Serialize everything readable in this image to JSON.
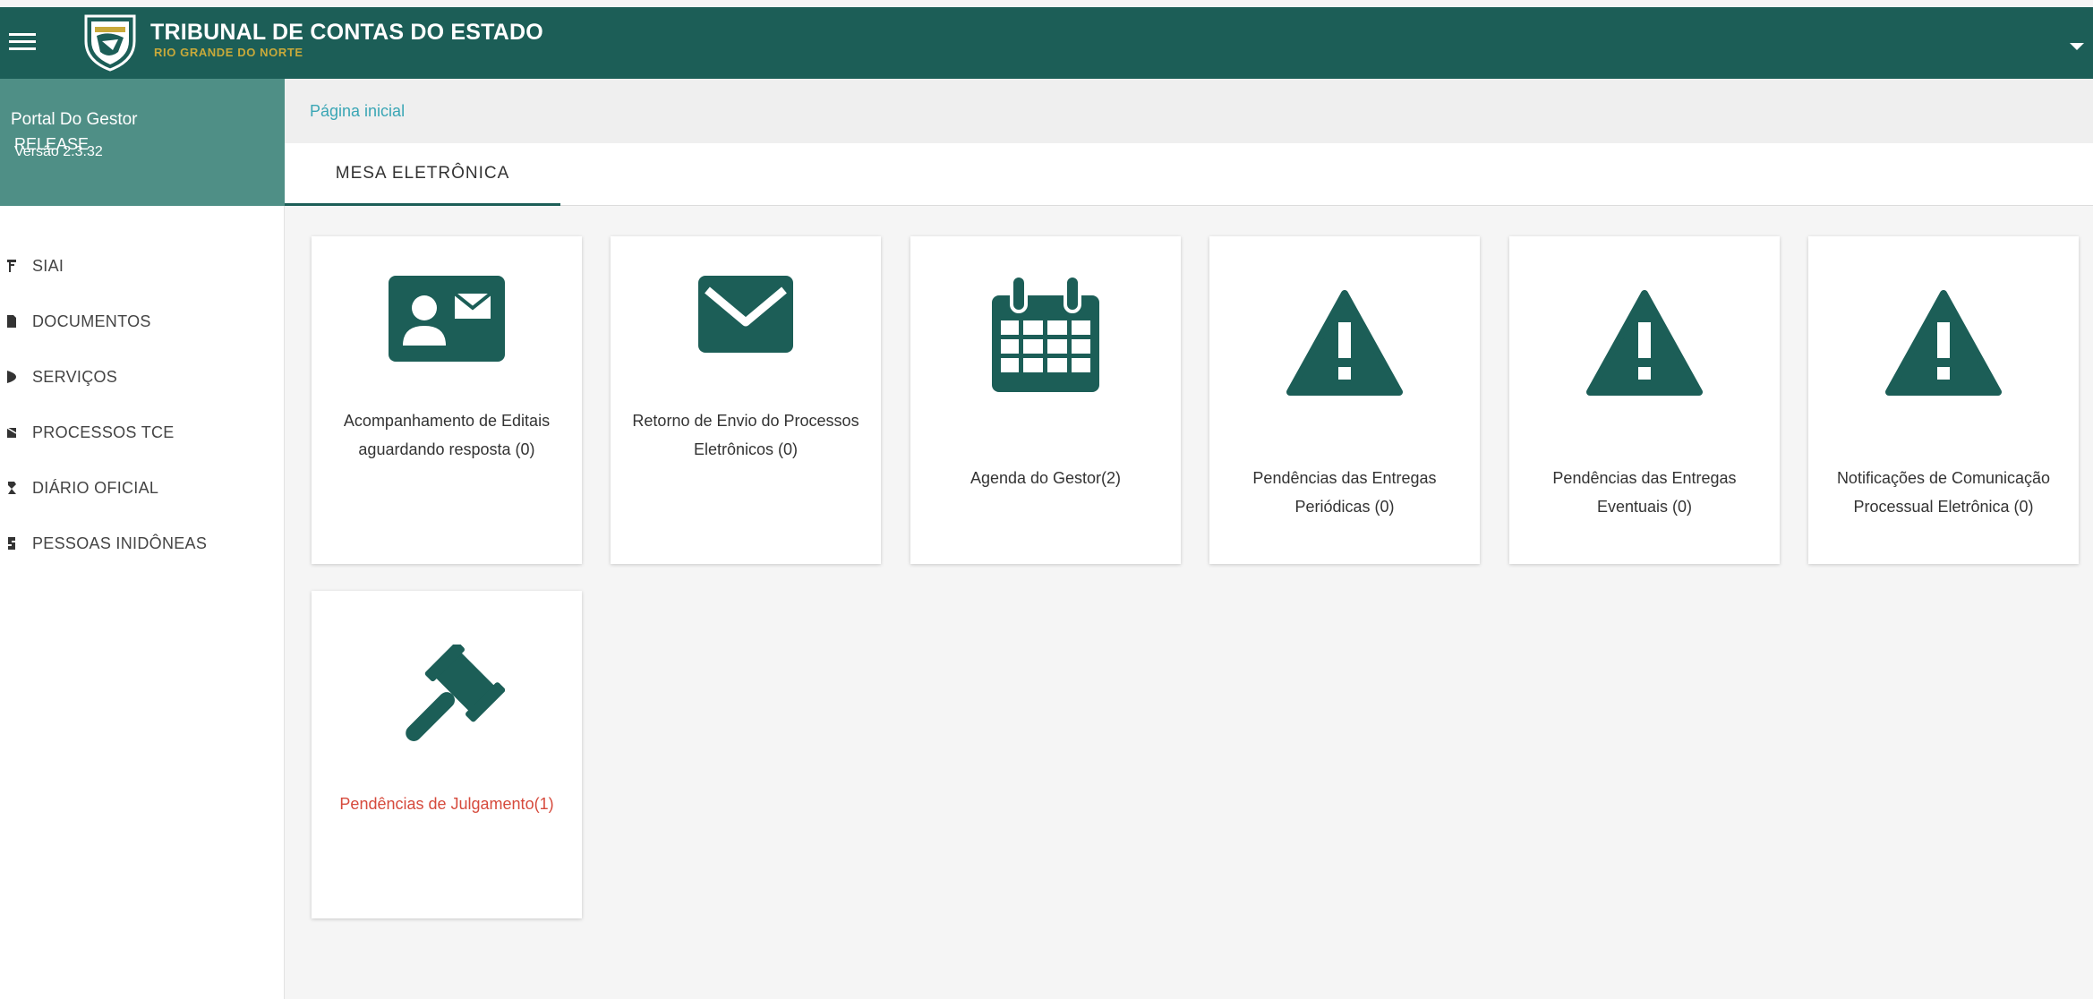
{
  "header": {
    "title": "TRIBUNAL DE CONTAS DO ESTADO",
    "subtitle": "RIO GRANDE DO NORTE"
  },
  "sidebar": {
    "portal_name": "Portal Do Gestor",
    "release": "RELEASE",
    "version": "Versão 2.3.32",
    "items": [
      {
        "label": "SIAI",
        "icon": "tool-icon"
      },
      {
        "label": "DOCUMENTOS",
        "icon": "document-icon"
      },
      {
        "label": "SERVIÇOS",
        "icon": "services-icon"
      },
      {
        "label": "PROCESSOS TCE",
        "icon": "folder-icon"
      },
      {
        "label": "DIÁRIO OFICIAL",
        "icon": "journal-icon"
      },
      {
        "label": "PESSOAS INIDÔNEAS",
        "icon": "person-icon"
      }
    ]
  },
  "breadcrumb": {
    "home": "Página inicial"
  },
  "tabs": [
    {
      "label": "MESA ELETRÔNICA",
      "active": true
    }
  ],
  "cards": [
    {
      "label": "Acompanhamento de Editais aguardando resposta (0)",
      "icon": "contact-card-icon"
    },
    {
      "label": "Retorno de Envio do Processos Eletrônicos (0)",
      "icon": "envelope-icon"
    },
    {
      "label": "Agenda do Gestor(2)",
      "icon": "calendar-icon"
    },
    {
      "label": "Pendências das Entregas Periódicas (0)",
      "icon": "warning-icon"
    },
    {
      "label": "Pendências das Entregas Eventuais (0)",
      "icon": "warning-icon"
    },
    {
      "label": "Notificações de Comunicação Processual Eletrônica (0)",
      "icon": "warning-icon"
    },
    {
      "label": "Pendências de Julgamento(1)",
      "icon": "gavel-icon"
    }
  ],
  "colors": {
    "primary": "#1c5e57",
    "sidebar_header": "#4f8f86",
    "link": "#3aa6b5",
    "danger": "#d64a3c",
    "gold": "#c8a93a"
  }
}
